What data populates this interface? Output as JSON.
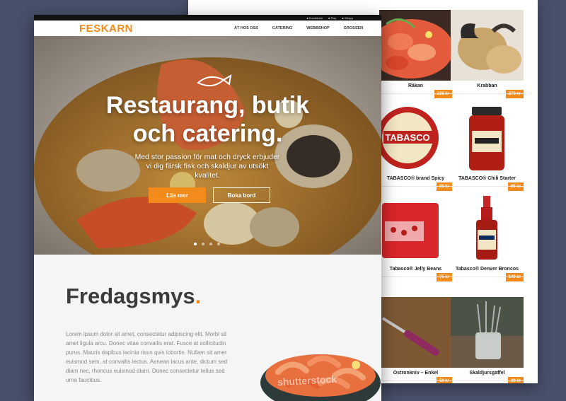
{
  "shop": {
    "products": [
      {
        "name": "Räkan",
        "price": "195 kr"
      },
      {
        "name": "Krabban",
        "price": "270 kr"
      },
      {
        "name": "TABASCO® brand Spicy",
        "price": "85 kr"
      },
      {
        "name": "TABASCO® Chili Starter",
        "price": "65 kr"
      },
      {
        "name": "Tabasco® Jelly Beans",
        "price": "75 kr"
      },
      {
        "name": "Tabasco® Denver Broncos",
        "price": "140 kr"
      },
      {
        "name": "Ostronkniv – Enkel",
        "price": "50 kr"
      },
      {
        "name": "Skaldjursgaffel",
        "price": "30 kr"
      }
    ]
  },
  "topbar": {
    "links": [
      "Kundklubb",
      "Play",
      "Kitlapp"
    ]
  },
  "header": {
    "logo": "FESKARN",
    "menu": [
      "ÄT HOS OSS",
      "CATERING",
      "WEBBSHOP",
      "GROSSEN"
    ]
  },
  "hero": {
    "title_line1": "Restaurang, butik",
    "title_line2": "och catering.",
    "subtitle": "Med stor passion för mat och dryck erbjuder vi dig färsk fisk och skaldjur av utsökt kvalitet.",
    "primary_button": "Läs mer",
    "secondary_button": "Boka bord",
    "slides": 4,
    "active_slide": 0
  },
  "feature": {
    "title": "Fredagsmys",
    "title_accent": ".",
    "body": "Lorem ipsum dolor sit amet, consectetur adipiscing elit. Morbi sit amet ligula arcu. Donec vitae convallis erat. Fusce at sollicitudin purus. Mauris dapibus lacinia risus quis lobortis. Nullam sit amet euismod sem, at convallis lectus. Aenean lacus ante, dictum sed diam nec, rhoncus euismod diam. Donec consectetur tellus sed urna faucibus."
  },
  "watermark": "shutterstock",
  "colors": {
    "accent": "#f38b1c",
    "background": "#48506a",
    "dark": "#3b3b3b"
  }
}
